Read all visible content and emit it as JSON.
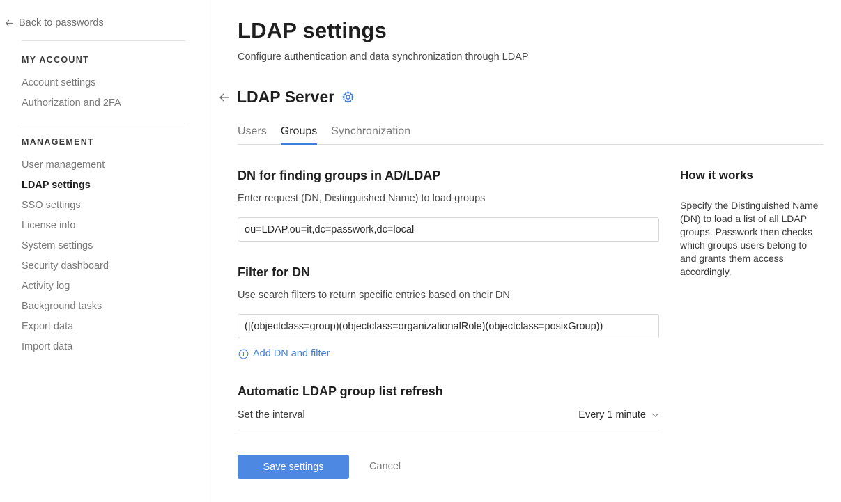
{
  "sidebar": {
    "back_label": "Back to passwords",
    "my_account": {
      "heading": "MY ACCOUNT",
      "items": [
        "Account settings",
        "Authorization and 2FA"
      ]
    },
    "management": {
      "heading": "MANAGEMENT",
      "items": [
        "User management",
        "LDAP settings",
        "SSO settings",
        "License info",
        "System settings",
        "Security dashboard",
        "Activity log",
        "Background tasks",
        "Export data",
        "Import data"
      ],
      "active": "LDAP settings"
    }
  },
  "header": {
    "title": "LDAP settings",
    "subtitle": "Configure authentication and data synchronization through LDAP"
  },
  "server": {
    "title": "LDAP Server"
  },
  "tabs": [
    {
      "label": "Users",
      "active": false
    },
    {
      "label": "Groups",
      "active": true
    },
    {
      "label": "Synchronization",
      "active": false
    }
  ],
  "dn_section": {
    "title": "DN for finding groups in AD/LDAP",
    "description": "Enter request (DN, Distinguished Name) to load groups",
    "value": "ou=LDAP,ou=it,dc=passwork,dc=local"
  },
  "filter_section": {
    "title": "Filter for DN",
    "description": "Use search filters to return specific entries based on their DN",
    "value": "(|(objectclass=group)(objectclass=organizationalRole)(objectclass=posixGroup))"
  },
  "add_link": "Add DN and filter",
  "refresh_section": {
    "title": "Automatic LDAP group list refresh",
    "interval_label": "Set the interval",
    "interval_value": "Every 1 minute"
  },
  "actions": {
    "save": "Save settings",
    "cancel": "Cancel"
  },
  "how_it_works": {
    "title": "How it works",
    "text": "Specify the Distinguished Name (DN) to load a list of all LDAP groups. Passwork then checks which groups users belong to and grants them access accordingly."
  },
  "colors": {
    "accent": "#3d7ddb",
    "button": "#4d88e3"
  },
  "icons": {
    "back": "arrow-left-icon",
    "settings": "gear-icon",
    "add": "plus-circle-icon",
    "dropdown": "chevron-down-icon"
  }
}
